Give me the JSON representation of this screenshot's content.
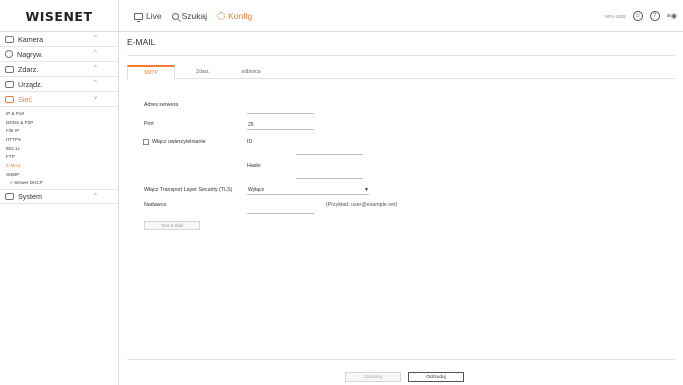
{
  "app": {
    "logo": "WISENET",
    "model": "HRX-1635"
  },
  "nav": {
    "live": "Live",
    "search": "Szukaj",
    "setup": "Konfig"
  },
  "sidebar": {
    "groups": [
      {
        "label": "Kamera"
      },
      {
        "label": "Nagryw."
      },
      {
        "label": "Zdarz."
      },
      {
        "label": "Urządz."
      },
      {
        "label": "Sieć"
      },
      {
        "label": "System"
      }
    ],
    "network_items": [
      "IP & Port",
      "DDNS & P2P",
      "Filtr IP",
      "HTTPS",
      "802.1x",
      "FTP",
      "E-MAIL",
      "SNMP",
      "> Serwer DHCP"
    ]
  },
  "page": {
    "title": "E-MAIL",
    "tabs": [
      "SMTP",
      "Zdarz.",
      "odbiorca"
    ],
    "form": {
      "server_label": "Adres serwera",
      "server_value": "",
      "port_label": "Port",
      "port_value": "25",
      "auth_label": "Włącz uwierzytelnianie",
      "id_label": "ID",
      "id_value": "",
      "password_label": "Hasło",
      "password_value": "",
      "tls_label": "Włącz Transport Layer Security (TLS)",
      "tls_value": "Wyłącz",
      "sender_label": "Nadawca",
      "sender_value": "",
      "sender_hint": "(Przykład: user@example.net)",
      "test_button": "Test e-mail"
    },
    "buttons": {
      "apply": "Zastosuj",
      "cancel": "Odrzuduj"
    }
  },
  "colors": {
    "accent": "#f07c32",
    "divider": "#e2e2e2"
  }
}
